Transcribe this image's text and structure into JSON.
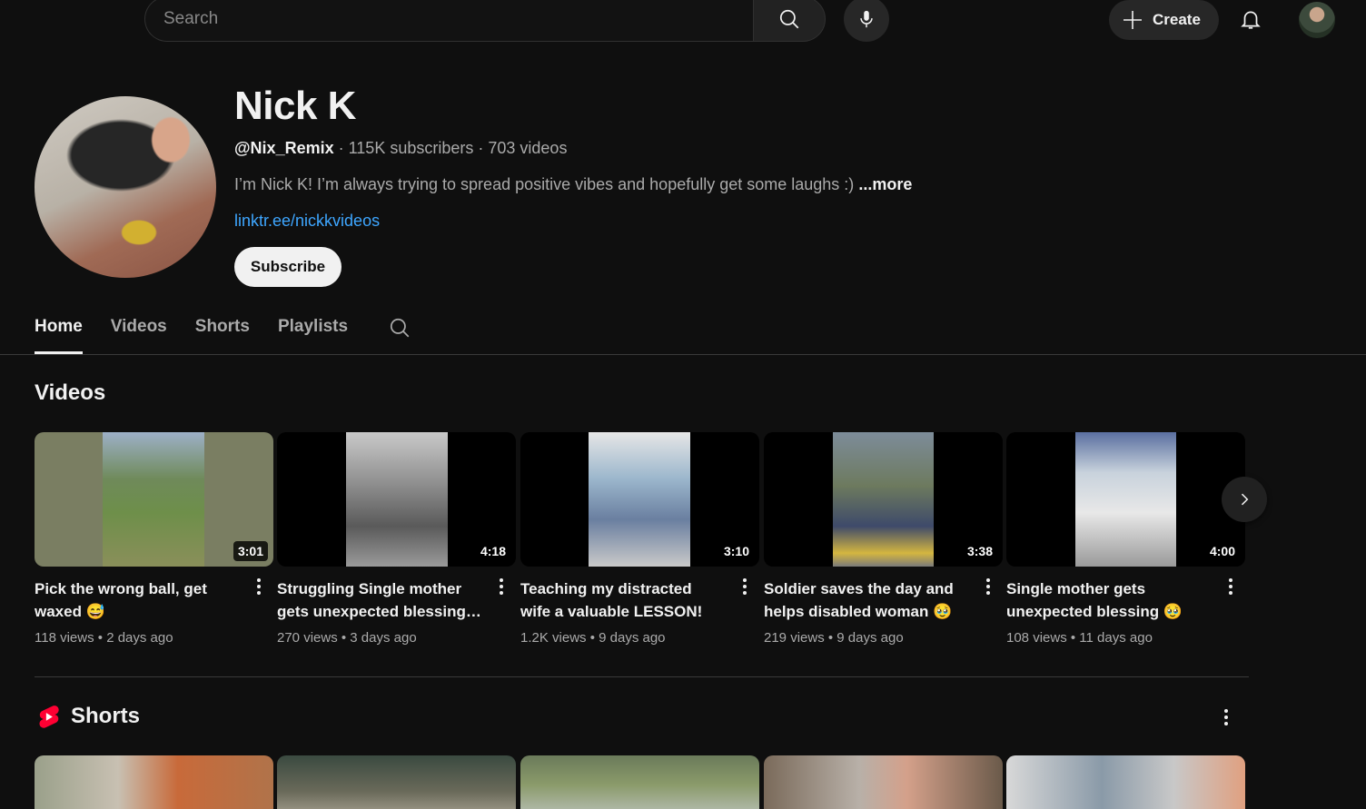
{
  "topbar": {
    "search_placeholder": "Search",
    "create_label": "Create"
  },
  "channel": {
    "name": "Nick K",
    "handle": "@Nix_Remix",
    "subscribers": "115K subscribers",
    "videos_count": "703 videos",
    "description": "I’m Nick K! I’m always trying to spread positive vibes and hopefully get some laughs :)",
    "more_label": "...more",
    "link": "linktr.ee/nickkvideos",
    "subscribe_label": "Subscribe"
  },
  "tabs": [
    {
      "label": "Home",
      "active": true
    },
    {
      "label": "Videos",
      "active": false
    },
    {
      "label": "Shorts",
      "active": false
    },
    {
      "label": "Playlists",
      "active": false
    }
  ],
  "videos_section": {
    "title": "Videos",
    "items": [
      {
        "title": "Pick the wrong ball, get waxed 😅",
        "duration": "3:01",
        "views": "118 views",
        "age": "2 days ago"
      },
      {
        "title": "Struggling Single mother gets unexpected blessing…",
        "duration": "4:18",
        "views": "270 views",
        "age": "3 days ago"
      },
      {
        "title": "Teaching my distracted wife a valuable LESSON! 😱",
        "duration": "3:10",
        "views": "1.2K views",
        "age": "9 days ago"
      },
      {
        "title": "Soldier saves the day and helps disabled woman 🥹",
        "duration": "3:38",
        "views": "219 views",
        "age": "9 days ago"
      },
      {
        "title": "Single mother gets unexpected blessing 🥹",
        "duration": "4:00",
        "views": "108 views",
        "age": "11 days ago"
      }
    ]
  },
  "shorts_section": {
    "title": "Shorts"
  },
  "icons": {
    "search": "search-icon",
    "mic": "mic-icon",
    "create": "plus-icon",
    "notifications": "bell-icon",
    "next": "chevron-right-icon",
    "shorts": "shorts-logo-icon",
    "more": "kebab-icon"
  },
  "colors": {
    "background": "#0f0f0f",
    "link": "#3ea6ff",
    "shorts_red": "#ff0033"
  }
}
